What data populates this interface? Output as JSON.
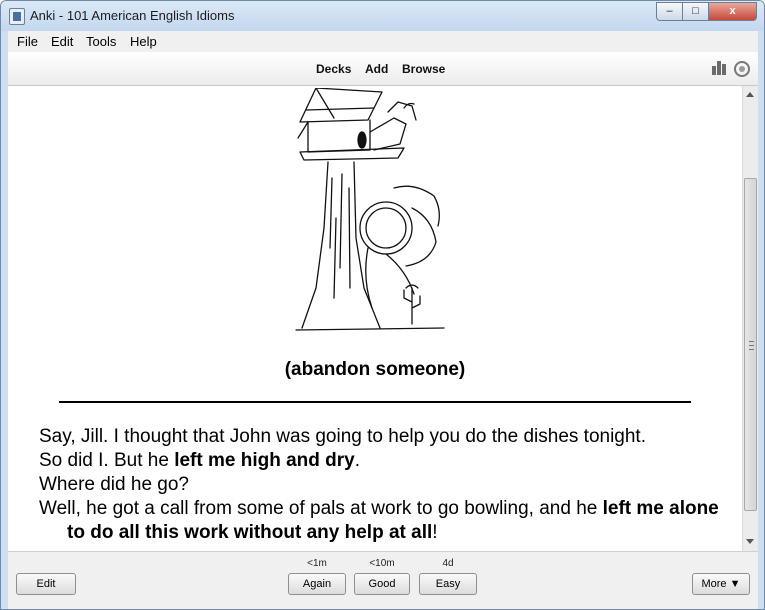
{
  "window": {
    "title": "Anki - 101 American English Idioms",
    "controls": {
      "minimize": "–",
      "maximize": "□",
      "close": "x"
    }
  },
  "menu": [
    "File",
    "Edit",
    "Tools",
    "Help"
  ],
  "toolbar": {
    "links": [
      "Decks",
      "Add",
      "Browse"
    ],
    "icons": [
      "stats-icon",
      "sync-icon"
    ]
  },
  "card": {
    "image": "birdhouse-tree-illustration",
    "caption": "(abandon someone)",
    "dialogue": [
      [
        {
          "t": "Say, Jill. I thought that John was going to help you do the dishes tonight.",
          "b": false
        }
      ],
      [
        {
          "t": "So did I. But he ",
          "b": false
        },
        {
          "t": "left me high and dry",
          "b": true
        },
        {
          "t": ".",
          "b": false
        }
      ],
      [
        {
          "t": "Where did he go?",
          "b": false
        }
      ],
      [
        {
          "t": "Well, he got a call from some of pals at work to go bowling, and he ",
          "b": false
        },
        {
          "t": "left me alone to do all this work without any help at all",
          "b": true
        },
        {
          "t": "!",
          "b": false
        }
      ]
    ]
  },
  "review": {
    "edit_label": "Edit",
    "more_label": "More ▼",
    "answers": [
      {
        "label": "Again",
        "interval": "<1m"
      },
      {
        "label": "Good",
        "interval": "<10m"
      },
      {
        "label": "Easy",
        "interval": "4d"
      }
    ]
  }
}
